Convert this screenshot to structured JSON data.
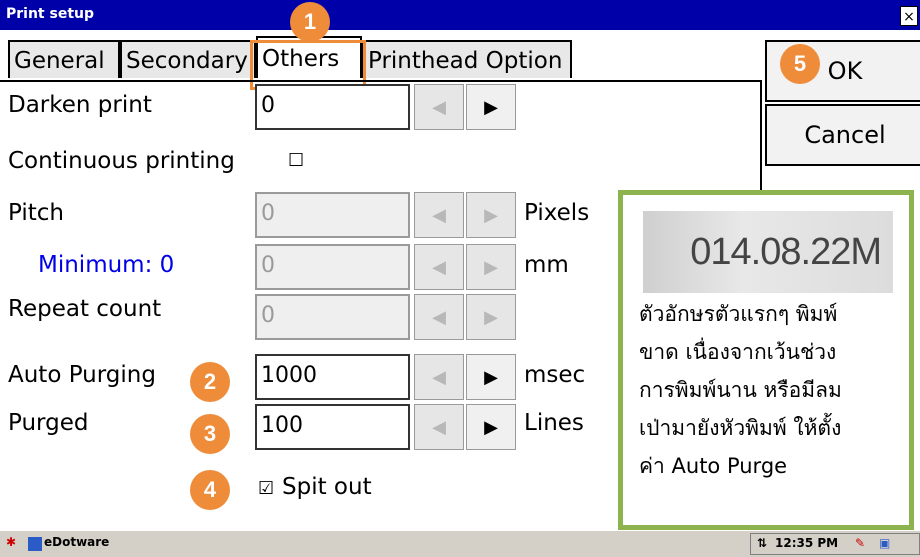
{
  "window": {
    "title": "Print setup",
    "close_glyph": "×"
  },
  "tabs": [
    "General",
    "Secondary",
    "Others",
    "Printhead Option"
  ],
  "active_tab": "Others",
  "fields": {
    "darken_print": {
      "label": "Darken print",
      "value": "0"
    },
    "continuous_printing": {
      "label": "Continuous printing",
      "checked": false
    },
    "pitch": {
      "label": "Pitch",
      "value": "0",
      "unit": "Pixels"
    },
    "minimum": {
      "label": "Minimum: 0",
      "value": "0",
      "unit": "mm"
    },
    "repeat_count": {
      "label": "Repeat count",
      "value": "0"
    },
    "auto_purging": {
      "label": "Auto Purging",
      "value": "1000",
      "unit": "msec"
    },
    "purged": {
      "label": "Purged",
      "value": "100",
      "unit": "Lines"
    },
    "spit_out": {
      "label": "Spit out",
      "checked": true
    }
  },
  "buttons": {
    "ok": "OK",
    "cancel": "Cancel"
  },
  "badges": [
    "1",
    "2",
    "3",
    "4",
    "5"
  ],
  "callout": {
    "image_text": "014.08.22M",
    "lines": [
      "ตัวอักษรตัวแรกๆ พิมพ์",
      "ขาด เนื่องจากเว้นช่วง",
      "การพิมพ์นาน หรือมีลม",
      "เป่ามายังหัวพิมพ์ ให้ตั้ง",
      "ค่า Auto Purge"
    ]
  },
  "taskbar": {
    "app": "eDotware",
    "time": "12:35 PM"
  },
  "colors": {
    "titlebar": "#0000a8",
    "badge": "#ee8c3a",
    "callout_border": "#8cb34e",
    "minimum_label": "#0000e6"
  }
}
